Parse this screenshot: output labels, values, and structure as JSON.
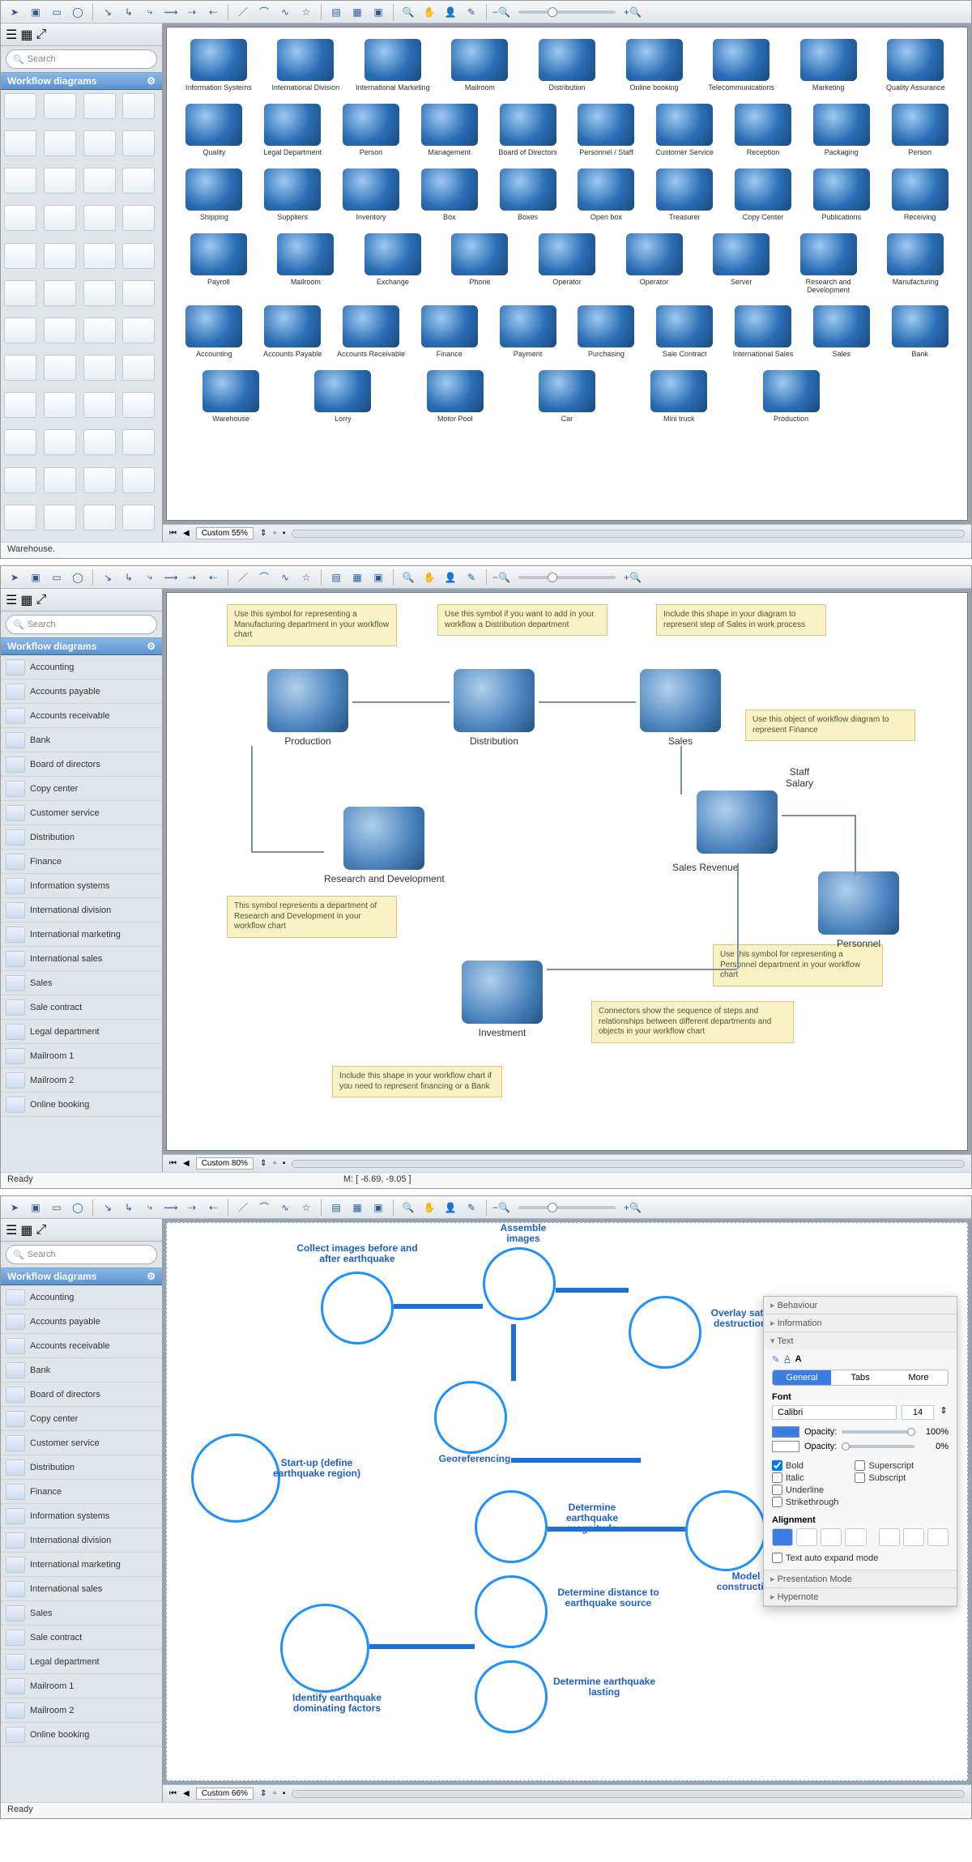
{
  "search_placeholder": "Search",
  "sidebar_title": "Workflow diagrams",
  "panel1": {
    "zoom_label": "Custom 55%",
    "status": "Warehouse.",
    "icons": {
      "row1": [
        "Information Systems",
        "International Division",
        "International Marketing",
        "Mailroom",
        "Distribution",
        "Online booking",
        "Telecommunications",
        "Marketing",
        "Quality Assurance"
      ],
      "row2": [
        "Quality",
        "Legal Department",
        "Person",
        "Management",
        "Board of Directors",
        "Personnel / Staff",
        "Customer Service",
        "Reception",
        "Packaging",
        "Person"
      ],
      "row3": [
        "Shipping",
        "Suppliers",
        "Inventory",
        "Box",
        "Boxes",
        "Open box",
        "Treasurer",
        "Copy Center",
        "Publications",
        "Receiving"
      ],
      "row4": [
        "Payroll",
        "Mailroom",
        "Exchange",
        "Phone",
        "Operator",
        "Operator",
        "Server",
        "Research and Development",
        "Manufacturing"
      ],
      "row5": [
        "Accounting",
        "Accounts Payable",
        "Accounts Receivable",
        "Finance",
        "Payment",
        "Purchasing",
        "Sale Contract",
        "International Sales",
        "Sales",
        "Bank"
      ],
      "row6": [
        "Warehouse",
        "Lorry",
        "Motor Pool",
        "Car",
        "Mini truck",
        "Production"
      ]
    }
  },
  "panel2": {
    "zoom_label": "Custom 80%",
    "status": "Ready",
    "mouse": "M: [ -6.69, -9.05 ]",
    "sidebar_items": [
      "Accounting",
      "Accounts payable",
      "Accounts receivable",
      "Bank",
      "Board of directors",
      "Copy center",
      "Customer service",
      "Distribution",
      "Finance",
      "Information systems",
      "International division",
      "International marketing",
      "International sales",
      "Sales",
      "Sale contract",
      "Legal department",
      "Mailroom 1",
      "Mailroom 2",
      "Online booking"
    ],
    "nodes": {
      "production": "Production",
      "distribution": "Distribution",
      "sales": "Sales",
      "rd": "Research and Development",
      "staff_salary": "Staff Salary",
      "sales_revenue": "Sales Revenue",
      "personnel": "Personnel",
      "investment": "Investment"
    },
    "notes": {
      "n1": "Use this symbol for representing a Manufacturing department in your workflow chart",
      "n2": "Use this symbol if you want to add in your workflow a Distribution department",
      "n3": "Include this shape in your diagram to represent step of Sales in work process",
      "n4": "Use this object of workflow diagram to represent Finance",
      "n5": "This symbol represents a department of Research and Development in your workflow chart",
      "n6": "Use this symbol for representing a Personnel department in your workflow chart",
      "n7": "Connectors show the sequence of steps and relationships between different departments and objects in your workflow chart",
      "n8": "Include this shape in your workflow chart if you need to represent financing or a Bank"
    }
  },
  "panel3": {
    "zoom_label": "Custom 66%",
    "status": "Ready",
    "sidebar_items": [
      "Accounting",
      "Accounts payable",
      "Accounts receivable",
      "Bank",
      "Board of directors",
      "Copy center",
      "Customer service",
      "Distribution",
      "Finance",
      "Information systems",
      "International division",
      "International marketing",
      "International sales",
      "Sales",
      "Sale contract",
      "Legal department",
      "Mailroom 1",
      "Mailroom 2",
      "Online booking"
    ],
    "bubbles": {
      "startup": "Start-up (define earthquake region)",
      "collect": "Collect images before and after earthquake",
      "assemble": "Assemble images",
      "georef": "Georeferencing",
      "overlay": "Overlay satellite and destruction images",
      "magnitude": "Determine earthquake magnitude",
      "distance": "Determine distance to earthquake source",
      "lasting": "Determine earthquake lasting",
      "identify": "Identify earthquake dominating factors",
      "model": "Model construction"
    },
    "inspector": {
      "sections": [
        "Behaviour",
        "Information",
        "Text"
      ],
      "tabs": [
        "General",
        "Tabs",
        "More"
      ],
      "font_label": "Font",
      "font_name": "Calibri",
      "font_size": "14",
      "opacity_label": "Opacity:",
      "opacity1": "100%",
      "opacity2": "0%",
      "styles": {
        "bold": "Bold",
        "italic": "Italic",
        "underline": "Underline",
        "strike": "Strikethrough",
        "super": "Superscript",
        "sub": "Subscript"
      },
      "alignment_label": "Alignment",
      "auto_expand": "Text auto expand mode",
      "presentation": "Presentation Mode",
      "hypernote": "Hypernote"
    }
  }
}
